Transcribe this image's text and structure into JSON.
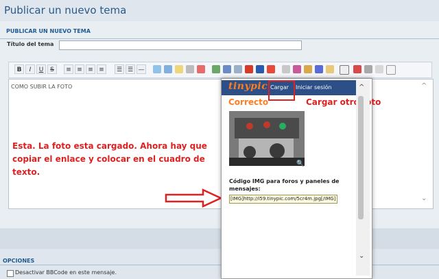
{
  "page": {
    "title": "Publicar un nuevo tema"
  },
  "form": {
    "section_label": "PUBLICAR UN NUEVO TEMA",
    "title_label": "Título del tema",
    "title_value": ""
  },
  "toolbar": {
    "buttons": [
      "B",
      "I",
      "U",
      "S"
    ]
  },
  "editor": {
    "content": "COMO SUBIR LA FOTO"
  },
  "annotations": {
    "instruction": "Esta. La foto esta cargado. Ahora hay que copiar el enlace y colocar en el cuadro de texto.",
    "cargar_note": "Cargar otro foto"
  },
  "popup": {
    "logo": "tinypic",
    "nav": [
      "Cargar",
      "Iniciar sesión"
    ],
    "status": "Correcto",
    "code_label": "Código IMG para foros y paneles de mensajes:",
    "code_value": "[IMG]http://i59.tinypic.com/5cr4m.jpg[/IMG]"
  },
  "options": {
    "label": "OPCIONES",
    "bbcode_label": "Desactivar BBCode en este mensaje."
  },
  "colors": {
    "accent": "#2a5a86",
    "annotation": "#e02121",
    "tinypic_orange": "#ff7d1e",
    "tinypic_header": "#2b4f86"
  }
}
